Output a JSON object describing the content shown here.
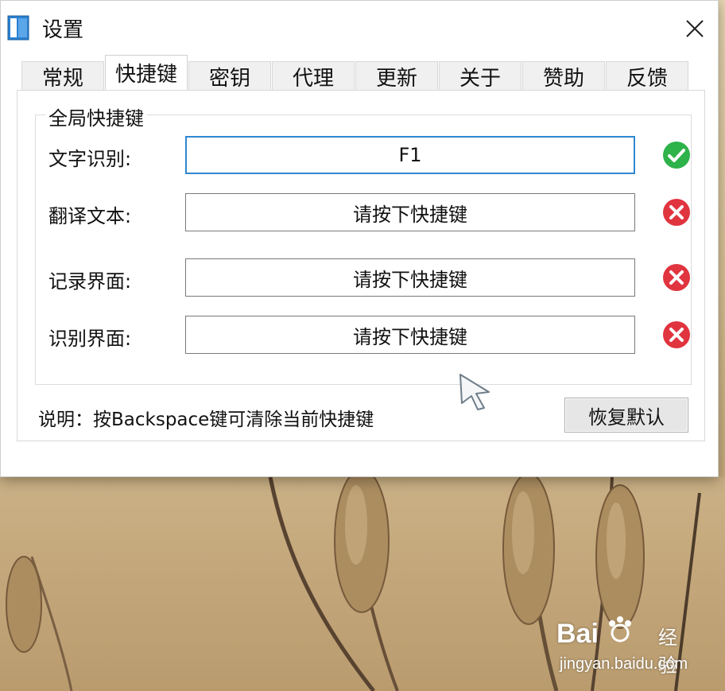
{
  "window": {
    "title": "设置",
    "icon": "notebook-app-icon",
    "close_icon": "close-icon"
  },
  "tabs": [
    {
      "label": "常规",
      "active": false
    },
    {
      "label": "快捷键",
      "active": true
    },
    {
      "label": "密钥",
      "active": false
    },
    {
      "label": "代理",
      "active": false
    },
    {
      "label": "更新",
      "active": false
    },
    {
      "label": "关于",
      "active": false
    },
    {
      "label": "赞助",
      "active": false
    },
    {
      "label": "反馈",
      "active": false
    }
  ],
  "group": {
    "title": "全局快捷键",
    "rows": [
      {
        "label": "文字识别:",
        "value": "F1",
        "status": "ok",
        "status_icon": "check-circle-icon"
      },
      {
        "label": "翻译文本:",
        "value": "请按下快捷键",
        "status": "error",
        "status_icon": "x-circle-icon"
      },
      {
        "label": "记录界面:",
        "value": "请按下快捷键",
        "status": "error",
        "status_icon": "x-circle-icon"
      },
      {
        "label": "识别界面:",
        "value": "请按下快捷键",
        "status": "error",
        "status_icon": "x-circle-icon"
      }
    ]
  },
  "note": "说明：按Backspace键可清除当前快捷键",
  "reset_button": "恢复默认",
  "colors": {
    "ok": "#2eb24a",
    "error": "#e0343f",
    "focus_border": "#2f87d0"
  },
  "watermark": {
    "brand": "Bai",
    "brand_suffix": "经验",
    "url": "jingyan.baidu.com"
  }
}
